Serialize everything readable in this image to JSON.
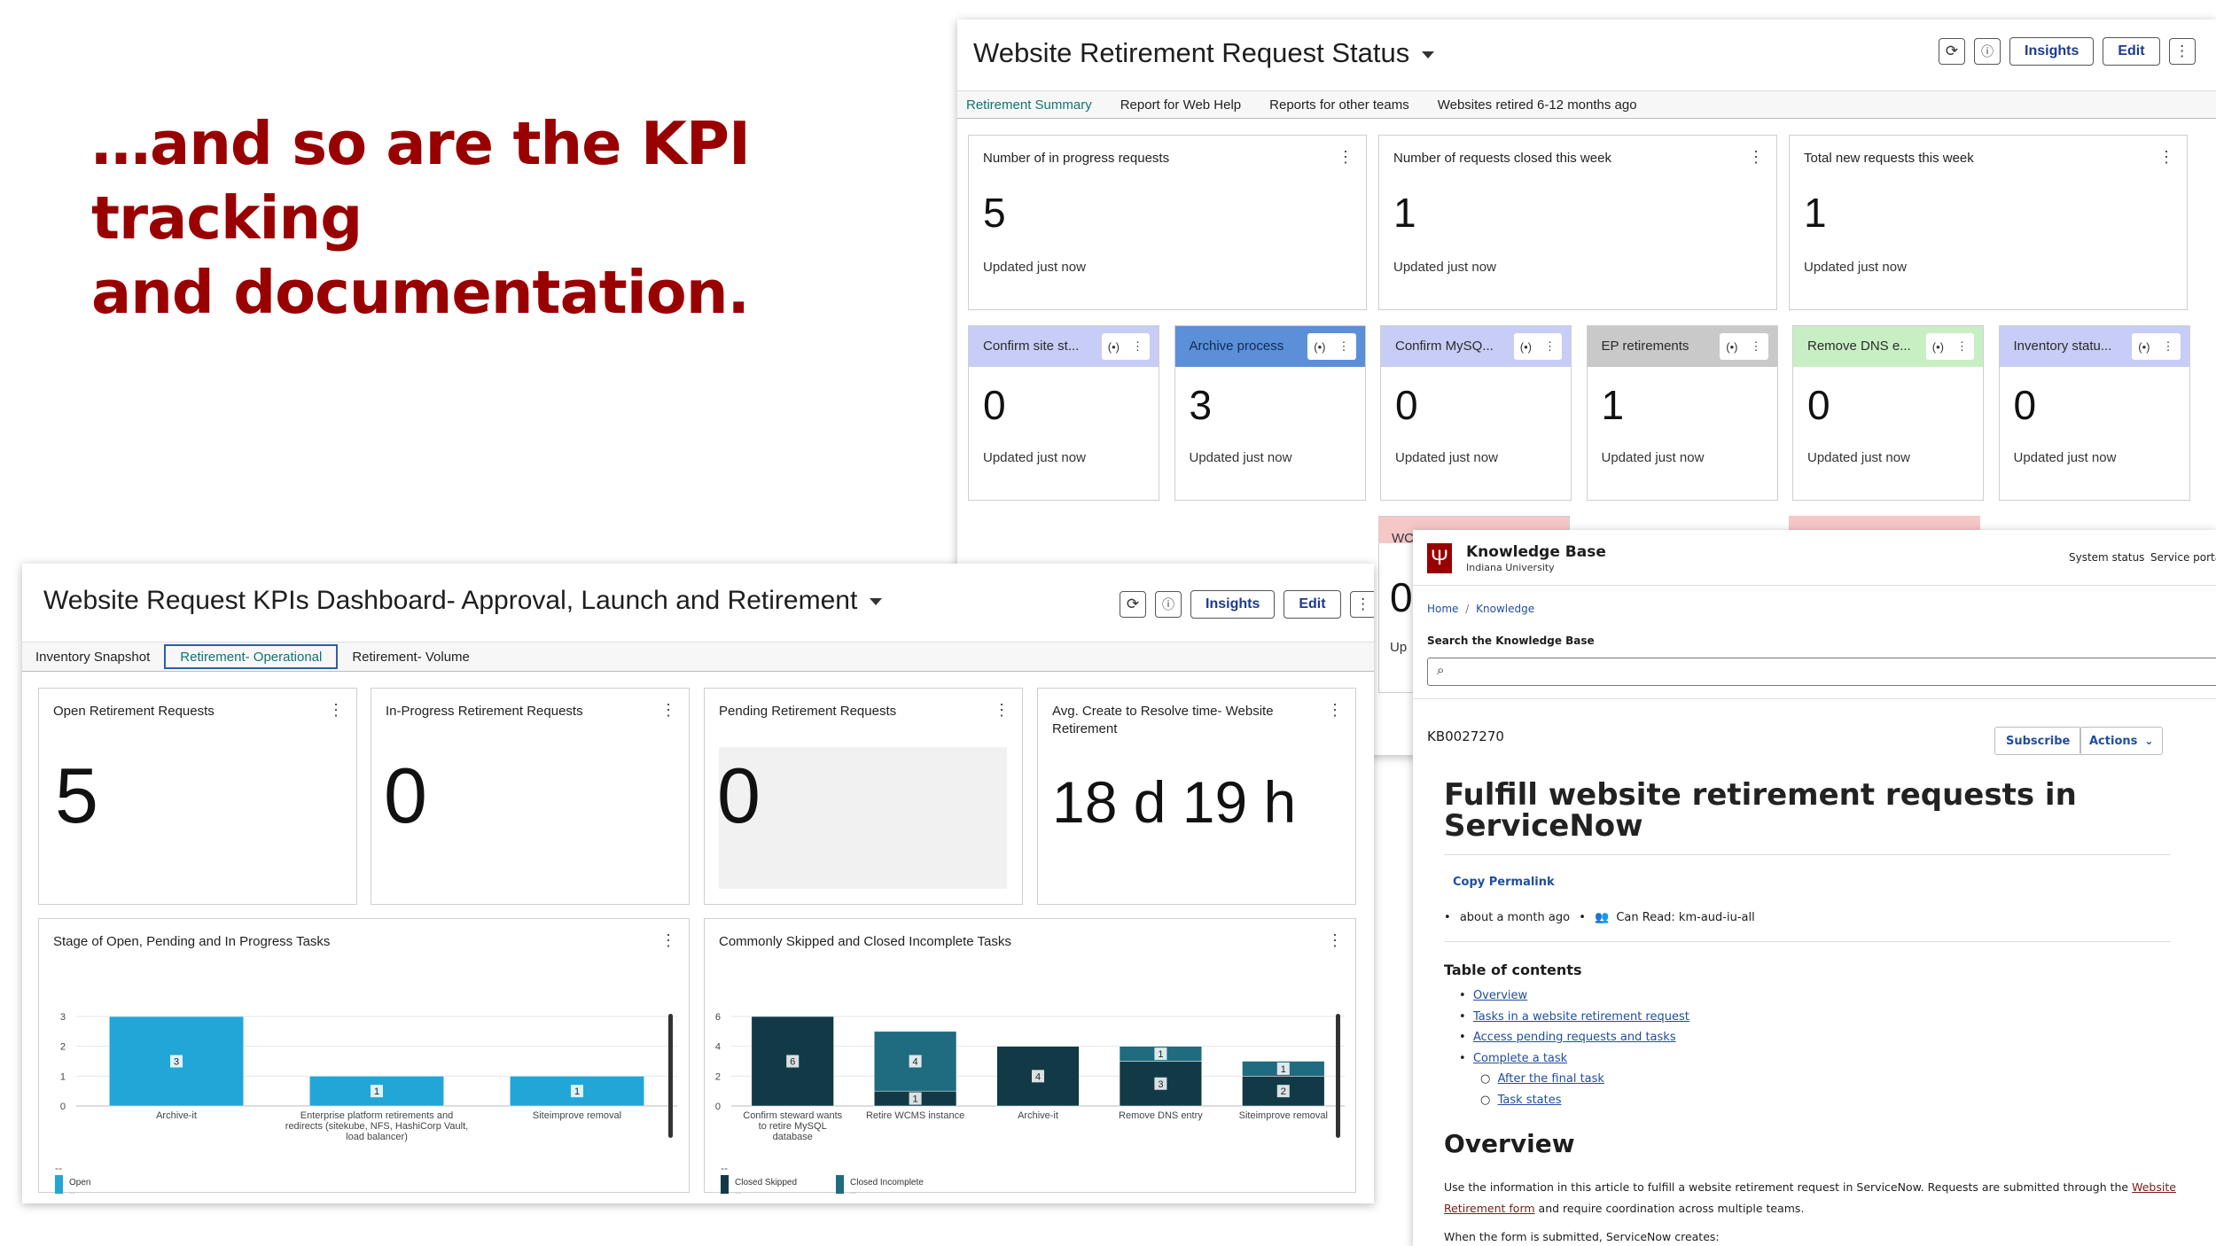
{
  "headline": {
    "line1": "…and so are the KPI tracking",
    "line2": "and documentation."
  },
  "retirement_status": {
    "title": "Website Retirement Request Status",
    "buttons": {
      "insights": "Insights",
      "edit": "Edit"
    },
    "tabs": [
      "Retirement Summary",
      "Report for Web Help",
      "Reports for other teams",
      "Websites retired 6-12 months ago"
    ],
    "kpis": [
      {
        "title": "Number of in progress requests",
        "value": "5",
        "updated": "Updated just now"
      },
      {
        "title": "Number of requests closed this week",
        "value": "1",
        "updated": "Updated just now"
      },
      {
        "title": "Total new requests this week",
        "value": "1",
        "updated": "Updated just now"
      }
    ],
    "minis": [
      {
        "title": "Confirm site st...",
        "value": "0",
        "updated": "Updated just now",
        "color": "#c7cdf6"
      },
      {
        "title": "Archive process",
        "value": "3",
        "updated": "Updated just now",
        "color": "#5b8fd8"
      },
      {
        "title": "Confirm MySQ...",
        "value": "0",
        "updated": "Updated just now",
        "color": "#c7cdf6"
      },
      {
        "title": "EP retirements",
        "value": "1",
        "updated": "Updated just now",
        "color": "#c9c9c9"
      },
      {
        "title": "Remove DNS e...",
        "value": "0",
        "updated": "Updated just now",
        "color": "#c8efc4"
      },
      {
        "title": "Inventory statu...",
        "value": "0",
        "updated": "Updated just now",
        "color": "#c7cdf6"
      }
    ],
    "partial": {
      "label": "WC",
      "value": "0",
      "updated": "Up"
    }
  },
  "kpi_dashboard": {
    "title": "Website Request KPIs Dashboard- Approval, Launch and Retirement",
    "buttons": {
      "insights": "Insights",
      "edit": "Edit"
    },
    "tabs": [
      "Inventory Snapshot",
      "Retirement- Operational",
      "Retirement- Volume"
    ],
    "cards": [
      {
        "title": "Open Retirement Requests",
        "value": "5"
      },
      {
        "title": "In-Progress Retirement Requests",
        "value": "0"
      },
      {
        "title": "Pending Retirement Requests",
        "value": "0"
      },
      {
        "title": "Avg. Create to Resolve time- Website Retirement",
        "value": "18 d 19 h"
      }
    ],
    "chart1_title": "Stage of Open, Pending and In Progress Tasks",
    "chart2_title": "Commonly Skipped and Closed Incomplete Tasks"
  },
  "chart_data": [
    {
      "type": "bar",
      "title": "Stage of Open, Pending and In Progress Tasks",
      "categories": [
        "Archive-it",
        "Enterprise platform retirements and redirects (sitekube, NFS, HashiCorp Vault, load balancer)",
        "Siteimprove removal"
      ],
      "series": [
        {
          "name": "Open",
          "values": [
            3,
            1,
            1
          ],
          "color": "#22a6d8"
        }
      ],
      "yticks": [
        0,
        1,
        2,
        3
      ],
      "ylim": [
        0,
        3
      ],
      "legend_value": "--",
      "footer": "--",
      "grid": true
    },
    {
      "type": "bar",
      "title": "Commonly Skipped and Closed Incomplete Tasks",
      "categories": [
        "Confirm steward wants to retire MySQL database",
        "Retire WCMS instance",
        "Archive-it",
        "Remove DNS entry",
        "Siteimprove removal"
      ],
      "series": [
        {
          "name": "Closed Skipped",
          "values": [
            6,
            1,
            4,
            3,
            2
          ],
          "color": "#123a46"
        },
        {
          "name": "Closed Incomplete",
          "values": [
            0,
            4,
            0,
            1,
            1
          ],
          "color": "#1f6b80"
        }
      ],
      "yticks": [
        0,
        2,
        4,
        6
      ],
      "ylim": [
        0,
        6
      ],
      "legend_value": "--",
      "footer": "--",
      "stacked": true,
      "grid": true
    }
  ],
  "knowledge_base": {
    "brand": "Knowledge Base",
    "org": "Indiana University",
    "logo_letter": "Ψ",
    "nav": [
      "System status",
      "Service porta"
    ],
    "breadcrumb": [
      "Home",
      "/",
      "Knowledge"
    ],
    "search_label": "Search the Knowledge Base",
    "article_id": "KB0027270",
    "subscribe": "Subscribe",
    "actions": "Actions",
    "title_line1": "Fulfill website retirement requests in",
    "title_line2": "ServiceNow",
    "permalink": "Copy Permalink",
    "meta_time": "about a month ago",
    "meta_read": "Can Read: km-aud-iu-all",
    "toc_title": "Table of contents",
    "toc": [
      "Overview",
      "Tasks in a website retirement request",
      "Access pending requests and tasks",
      "Complete a task"
    ],
    "toc_sub": [
      "After the final task",
      "Task states"
    ],
    "overview_heading": "Overview",
    "overview_text": "Use the information in this article to fulfill a website retirement request in ServiceNow. Requests are submitted through the",
    "overview_link": "Website Retirement form",
    "overview_text2": "and require coordination across multiple teams.",
    "overview_text3": "When the form is submitted, ServiceNow creates:"
  }
}
